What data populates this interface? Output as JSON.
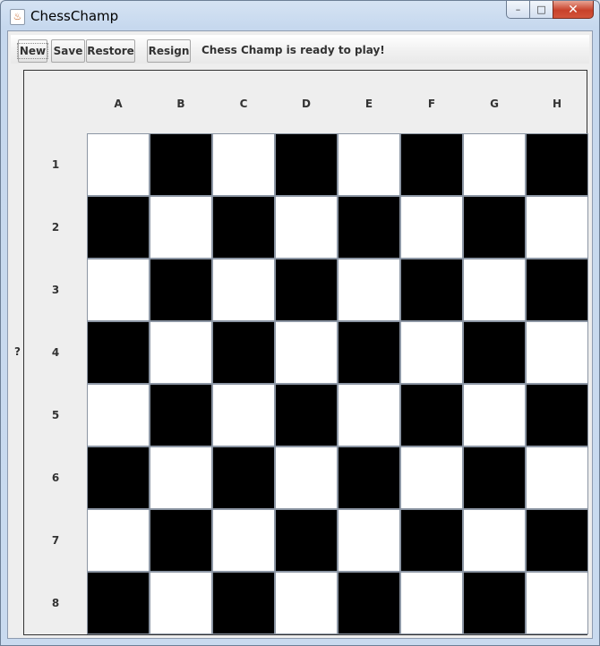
{
  "window": {
    "title": "ChessChamp",
    "icon": "java-cup-icon"
  },
  "titlebar_buttons": {
    "minimize": "–",
    "maximize": "□",
    "close": "✕"
  },
  "toolbar": {
    "new_label": "New",
    "save_label": "Save",
    "restore_label": "Restore",
    "resign_label": "Resign",
    "status": "Chess Champ is ready to play!"
  },
  "side_label": "?",
  "board": {
    "columns": [
      "A",
      "B",
      "C",
      "D",
      "E",
      "F",
      "G",
      "H"
    ],
    "rows": [
      "1",
      "2",
      "3",
      "4",
      "5",
      "6",
      "7",
      "8"
    ],
    "colors": {
      "light": "#ffffff",
      "dark": "#000000"
    },
    "top_left_square": "light"
  }
}
